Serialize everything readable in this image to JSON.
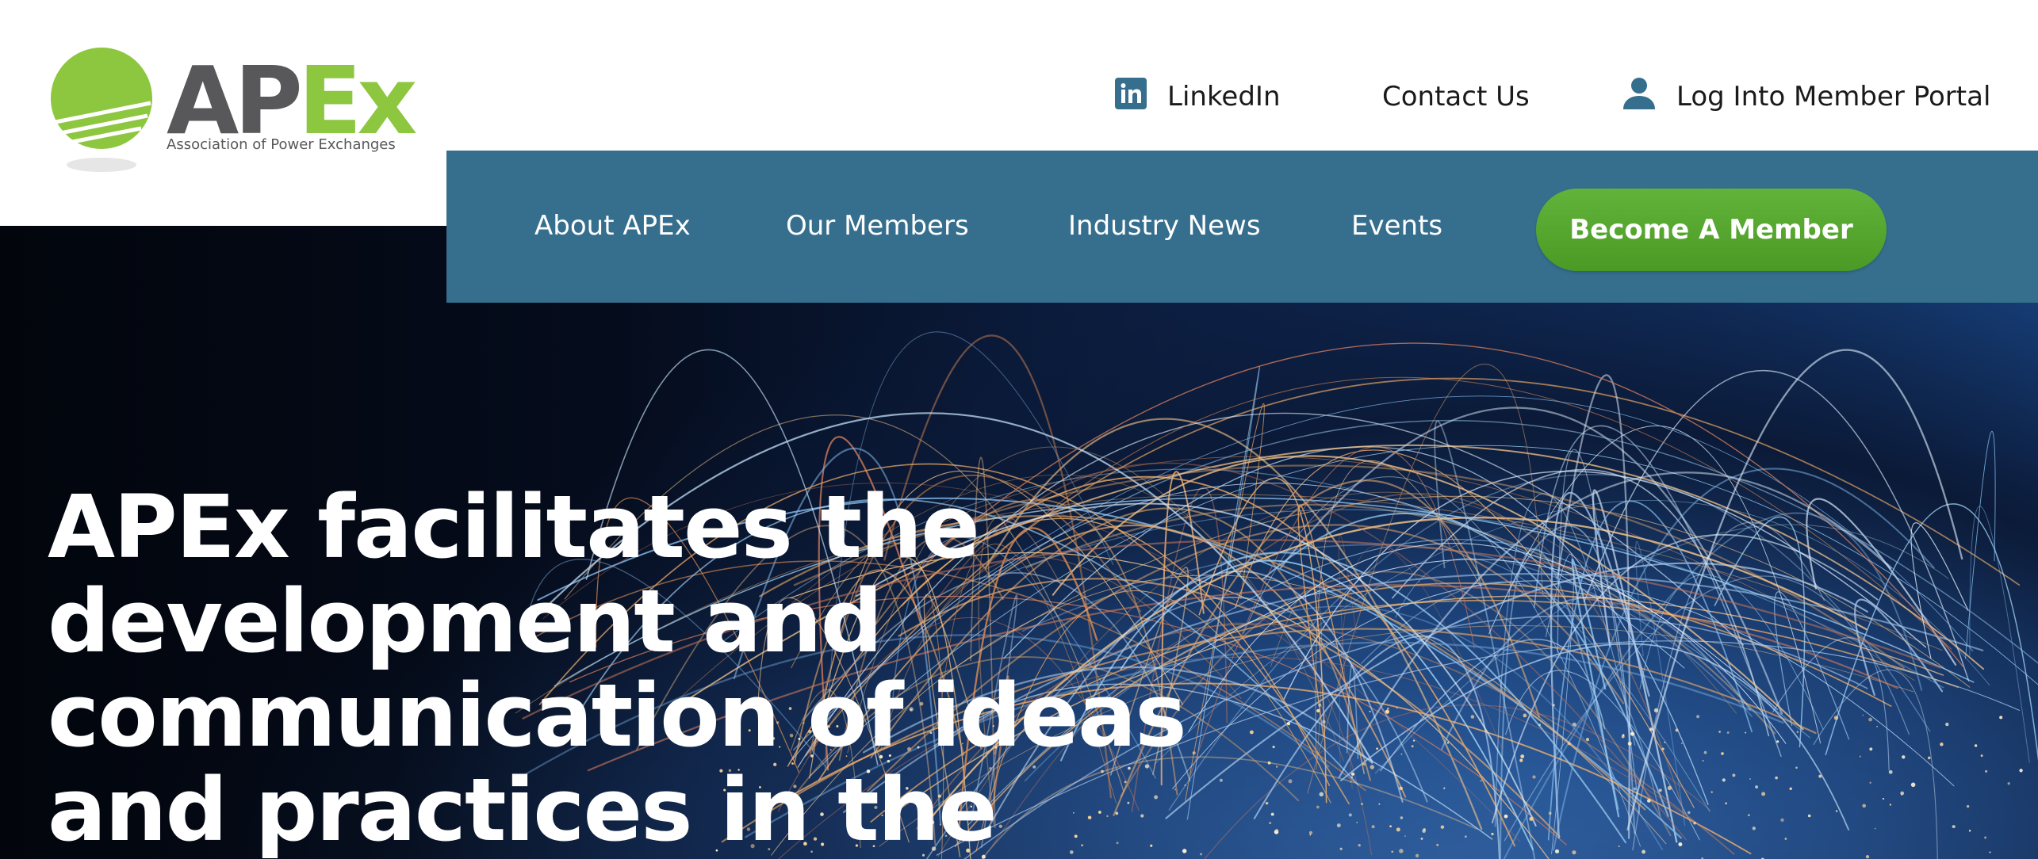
{
  "logo": {
    "wordmark_ap": "AP",
    "wordmark_ex": "Ex",
    "tagline": "Association of Power Exchanges"
  },
  "utility_nav": {
    "linkedin": "LinkedIn",
    "contact": "Contact Us",
    "login": "Log Into Member Portal"
  },
  "main_nav": {
    "items": [
      {
        "label": "About APEx"
      },
      {
        "label": "Our Members"
      },
      {
        "label": "Industry News"
      },
      {
        "label": "Events"
      }
    ],
    "cta": "Become A Member"
  },
  "hero": {
    "headline": "APEx facilitates the development and communication of ideas and practices in the"
  },
  "colors": {
    "nav_bar": "#366e8d",
    "brand_green": "#8dc63f",
    "cta_green": "#4a9a25",
    "logo_gray": "#58585a",
    "hero_dark": "#050c1c"
  },
  "icons": {
    "linkedin": "linkedin-icon",
    "user": "user-icon",
    "logo_mark": "logo-globe-icon",
    "hero_image": "network-arcs-globe"
  }
}
